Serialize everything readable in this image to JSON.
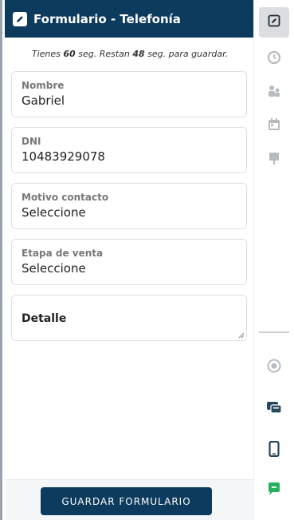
{
  "header": {
    "title": "Formulario - Telefonía",
    "icon": "edit-icon"
  },
  "timer": {
    "prefix": "Tienes",
    "total": "60",
    "middle": "seg. Restan",
    "remaining": "48",
    "suffix": "seg. para guardar."
  },
  "fields": [
    {
      "label": "Nombre",
      "value": "Gabriel"
    },
    {
      "label": "DNI",
      "value": "10483929078"
    },
    {
      "label": "Motivo contacto",
      "value": "Seleccione"
    },
    {
      "label": "Etapa de venta",
      "value": "Seleccione"
    }
  ],
  "detail": {
    "label": "Detalle"
  },
  "footer": {
    "save_label": "GUARDAR FORMULARIO"
  },
  "rail": {
    "top_icons": [
      "edit-icon",
      "history-icon",
      "users-icon",
      "calendar-icon",
      "pin-icon"
    ],
    "bottom_icons": [
      "settings-icon",
      "chat-bubbles-icon",
      "mobile-phone-icon",
      "whatsapp-message-icon"
    ],
    "colors": {
      "accent": "#0d3b5e",
      "muted_icon": "#b7bbc0",
      "dark_icon": "#27475e",
      "green_icon": "#25b25e"
    }
  }
}
